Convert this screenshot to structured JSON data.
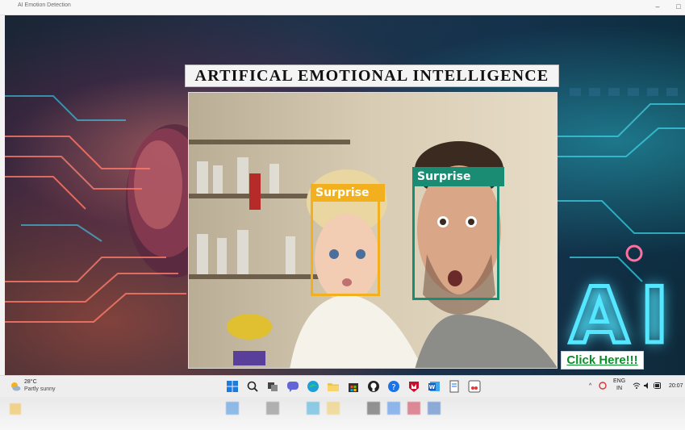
{
  "window": {
    "title": "AI Emotion Detection",
    "restore_glyph": "□"
  },
  "app": {
    "heading": "ARTIFICAL EMOTIONAL INTELLIGENCE",
    "background_letters": "AI",
    "cta_label": "Click Here!!!",
    "detections": [
      {
        "label": "Surprise",
        "color": "#f2b01e"
      },
      {
        "label": "Surprise",
        "color": "#1b8c74"
      }
    ]
  },
  "taskbar": {
    "weather_temp": "28°C",
    "weather_condition": "Partly sunny",
    "icons": [
      "windows-start-icon",
      "search-icon",
      "task-view-icon",
      "chat-icon",
      "edge-icon",
      "file-explorer-icon",
      "store-icon",
      "github-icon",
      "help-icon",
      "mcafee-icon",
      "word-icon",
      "notepad-icon",
      "snipping-tool-icon"
    ],
    "language_top": "ENG",
    "language_bottom": "IN",
    "time": "20:07"
  }
}
